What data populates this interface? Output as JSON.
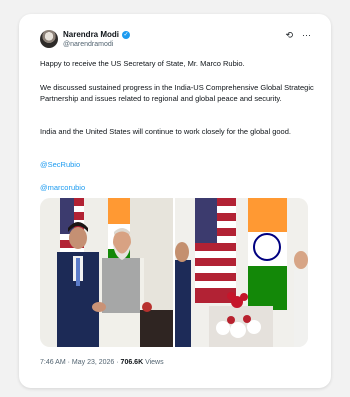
{
  "author": {
    "name": "Narendra Modi",
    "handle": "@narendramodi"
  },
  "header_icons": [
    "x-logo-icon",
    "more-icon"
  ],
  "tweet": {
    "p1": "Happy to receive the US Secretary of State, Mr. Marco Rubio.",
    "p2": "We discussed sustained progress in the India-US Comprehensive Global Strategic Partnership and issues related to regional and global peace and security.",
    "p3": "India and the United States will continue to work closely for the global good.",
    "mention1": "@SecRubio",
    "mention2": "@marcorubio"
  },
  "photos": [
    "handshake-photo",
    "meeting-photo"
  ],
  "meta": {
    "time": "7:46 AM · May 23, 2026 · ",
    "views_count": "706.6K",
    "views_label": " Views"
  }
}
